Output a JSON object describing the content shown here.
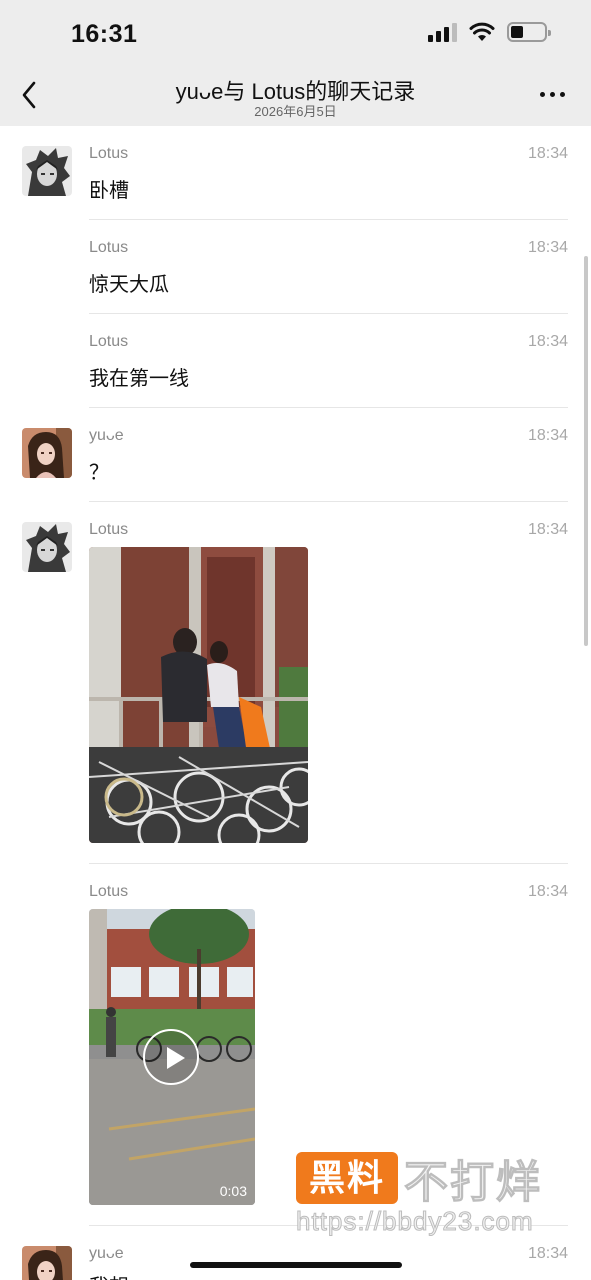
{
  "status_bar": {
    "time": "16:31"
  },
  "nav": {
    "title": "yuᴗe与 Lotus的聊天记录",
    "subtitle": "2026年6月5日"
  },
  "messages": [
    {
      "sender": "Lotus",
      "time": "18:34",
      "text": "卧槽",
      "avatar": "anime-avatar"
    },
    {
      "sender": "Lotus",
      "time": "18:34",
      "text": "惊天大瓜"
    },
    {
      "sender": "Lotus",
      "time": "18:34",
      "text": "我在第一线"
    },
    {
      "sender": "yuᴗe",
      "time": "18:34",
      "text": "？",
      "avatar": "girl-avatar"
    },
    {
      "sender": "Lotus",
      "time": "18:34",
      "type": "photo",
      "avatar": "anime-avatar"
    },
    {
      "sender": "Lotus",
      "time": "18:34",
      "type": "video",
      "duration": "0:03"
    },
    {
      "sender": "yuᴗe",
      "time": "18:34",
      "text": "我想",
      "avatar": "girl-avatar"
    }
  ],
  "watermark": {
    "badge": "黑料",
    "text": "不打烊",
    "url": "https://bbdy23.com"
  },
  "colors": {
    "nav_bg": "#ededed",
    "watermark_orange": "#f07a1c"
  }
}
